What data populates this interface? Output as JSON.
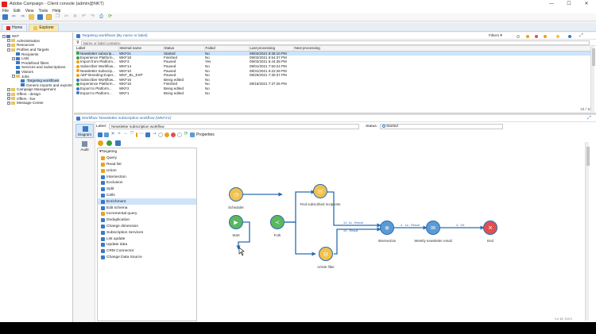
{
  "window": {
    "title": "Adobe Campaign - Client console (admin@NKT)",
    "controls": [
      "—",
      "☐",
      "✕"
    ]
  },
  "menu": [
    "File",
    "Edit",
    "View",
    "Tools",
    "Help"
  ],
  "tabs": [
    {
      "label": "Home"
    },
    {
      "label": "Explorer"
    }
  ],
  "tree": [
    {
      "label": "NKT",
      "indent": 0,
      "exp": "−",
      "icon": "blu"
    },
    {
      "label": "Administration",
      "indent": 1,
      "exp": "+",
      "icon": "fold"
    },
    {
      "label": "Resources",
      "indent": 1,
      "exp": "+",
      "icon": "fold"
    },
    {
      "label": "Profiles and Targets",
      "indent": 1,
      "exp": "−",
      "icon": "fold"
    },
    {
      "label": "Recipients",
      "indent": 2,
      "exp": "",
      "icon": "blu"
    },
    {
      "label": "Lists",
      "indent": 2,
      "exp": "+",
      "icon": "blu"
    },
    {
      "label": "Predefined filters",
      "indent": 2,
      "exp": "",
      "icon": "blu"
    },
    {
      "label": "Services and Subscriptions",
      "indent": 2,
      "exp": "",
      "icon": "blu"
    },
    {
      "label": "Visitors",
      "indent": 2,
      "exp": "",
      "icon": "blu"
    },
    {
      "label": "Jobs",
      "indent": 2,
      "exp": "−",
      "icon": "fold"
    },
    {
      "label": "Targeting workflows",
      "indent": 3,
      "exp": "",
      "icon": "blu",
      "selected": true
    },
    {
      "label": "Generic imports and exports",
      "indent": 3,
      "exp": "",
      "icon": "blu"
    },
    {
      "label": "Campaign Management",
      "indent": 1,
      "exp": "+",
      "icon": "fold"
    },
    {
      "label": "Offers - design",
      "indent": 1,
      "exp": "+",
      "icon": "fold"
    },
    {
      "label": "Offers - live",
      "indent": 1,
      "exp": "+",
      "icon": "fold"
    },
    {
      "label": "Message Center",
      "indent": 1,
      "exp": "+",
      "icon": "fold"
    }
  ],
  "list_panel": {
    "title": "Targeting workflows (By name or label)",
    "filters_label": "Filters",
    "search_placeholder": "Name or label contains:",
    "columns": [
      "Label",
      "Internal name",
      "Status",
      "Failed",
      "Last processing",
      "Next processing"
    ],
    "rows": [
      {
        "label": "Newsletter subscrip...",
        "internal": "WKF21",
        "status": "Started",
        "failed": "No",
        "last": "09/02/2021 9:38:10 PM",
        "next": "",
        "dot": "#3e9f3e"
      },
      {
        "label": "Experience Platform...",
        "internal": "WKF18",
        "status": "Finished",
        "failed": "No",
        "last": "09/02/2021 6:54:37 PM",
        "next": "",
        "dot": "#3e9f3e"
      },
      {
        "label": "Import from Platform...",
        "internal": "WKF3",
        "status": "Paused",
        "failed": "Yes",
        "last": "09/02/2021 6:44:38 PM",
        "next": "",
        "dot": "#e8a21b"
      },
      {
        "label": "Subscriber Workflow...",
        "internal": "WKF14",
        "status": "Paused",
        "failed": "No",
        "last": "09/01/2021 7:50:24 PM",
        "next": "",
        "dot": "#e8a21b"
      },
      {
        "label": "Newsletter Subscrip...",
        "internal": "WKF10",
        "status": "Paused",
        "failed": "No",
        "last": "08/31/2021 5:22:28 PM",
        "next": "",
        "dot": "#e8a21b"
      },
      {
        "label": "AEP Breeding Exper...",
        "internal": "WKF_BL_EXP",
        "status": "Paused",
        "failed": "No",
        "last": "08/26/2021 7:30:37 PM",
        "next": "",
        "dot": "#e8a21b"
      },
      {
        "label": "Subscriber Workflow...",
        "internal": "WKF16",
        "status": "Being edited",
        "failed": "No",
        "last": "",
        "next": "",
        "dot": "#3b79c4"
      },
      {
        "label": "Experience Platform...",
        "internal": "WKF15",
        "status": "Finished",
        "failed": "No",
        "last": "08/16/2021 7:37:26 PM",
        "next": "",
        "dot": "#3e9f3e"
      },
      {
        "label": "Export to Platform...",
        "internal": "WKF2",
        "status": "Being edited",
        "failed": "No",
        "last": "",
        "next": "",
        "dot": "#3b79c4"
      },
      {
        "label": "Export to Platform...",
        "internal": "WKF1",
        "status": "Being edited",
        "failed": "No",
        "last": "",
        "next": "",
        "dot": "#3b79c4"
      }
    ],
    "pager": "10 / 10"
  },
  "detail_panel": {
    "title": "Workflow 'Newsletter subscription workflow (WKF21)'",
    "side_buttons": [
      {
        "label": "Diagram",
        "active": true
      },
      {
        "label": "Audit",
        "active": false
      }
    ],
    "label_caption": "Label:",
    "label_value": "Newsletter subscription workflow",
    "status_caption": "Status:",
    "status_value": "Started",
    "properties_label": "Properties"
  },
  "palette": [
    {
      "label": "Targeting",
      "head": true,
      "color": ""
    },
    {
      "label": "Query",
      "color": "#e8a21b"
    },
    {
      "label": "Read list",
      "color": "#e8a21b"
    },
    {
      "label": "Union",
      "color": "#e8a21b"
    },
    {
      "label": "Intersection",
      "color": "#3b79c4"
    },
    {
      "label": "Exclusion",
      "color": "#3b79c4"
    },
    {
      "label": "Split",
      "color": "#3b79c4"
    },
    {
      "label": "Cells",
      "color": "#3b79c4"
    },
    {
      "label": "Enrichment",
      "color": "#3b79c4",
      "selected": true
    },
    {
      "label": "Edit schema",
      "color": "#3b79c4"
    },
    {
      "label": "Incremental query",
      "color": "#e8a21b"
    },
    {
      "label": "Deduplication",
      "color": "#3b79c4"
    },
    {
      "label": "Change dimension",
      "color": "#3b79c4"
    },
    {
      "label": "Subscription Services",
      "color": "#3b79c4"
    },
    {
      "label": "List update",
      "color": "#3b79c4"
    },
    {
      "label": "Update data",
      "color": "#3b79c4"
    },
    {
      "label": "CRM Connector",
      "color": "#3b79c4"
    },
    {
      "label": "Change Data Source",
      "color": "#3b79c4"
    }
  ],
  "workflow": {
    "nodes": [
      {
        "id": "scheduler",
        "label": "Scheduler",
        "color": "#f2c14e"
      },
      {
        "id": "start",
        "label": "Start",
        "color": "#5cb85c"
      },
      {
        "id": "fork",
        "label": "Fork",
        "color": "#5cb85c"
      },
      {
        "id": "find",
        "label": "Find subscribed recipients",
        "color": "#f2c14e"
      },
      {
        "id": "article",
        "label": "Article filter",
        "color": "#f2c14e"
      },
      {
        "id": "intersection",
        "label": "Intersection",
        "color": "#5b9bd5"
      },
      {
        "id": "email",
        "label": "Weekly newsletter email",
        "color": "#5b9bd5"
      },
      {
        "id": "end",
        "label": "End",
        "color": "#e05050"
      }
    ],
    "links": [
      {
        "label": "12, 1a - Result"
      },
      {
        "label": "14 - Result"
      },
      {
        "label": "4 - 1a - Result"
      },
      {
        "label": "4 - Ok"
      }
    ]
  },
  "status_bar": "Ln 10, Col 1"
}
